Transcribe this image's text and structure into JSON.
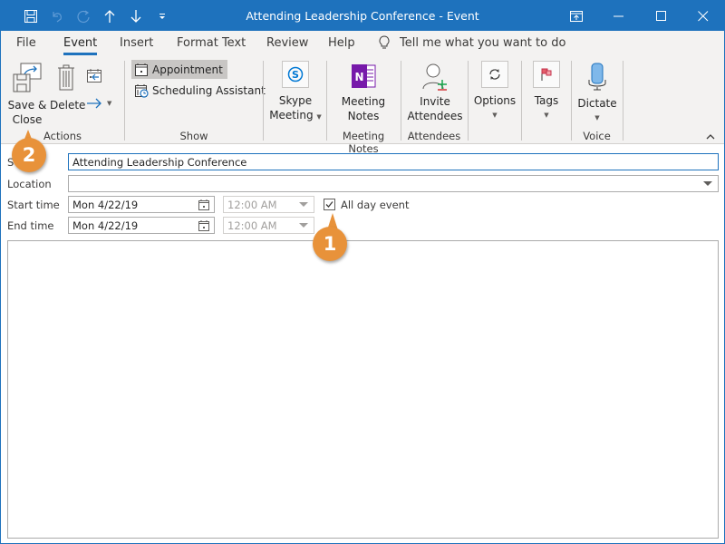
{
  "window": {
    "title": "Attending Leadership Conference  -  Event"
  },
  "quick_access": [
    {
      "icon": "save-icon"
    },
    {
      "icon": "undo-icon"
    },
    {
      "icon": "redo-icon"
    },
    {
      "icon": "up-arrow-icon"
    },
    {
      "icon": "down-arrow-icon"
    },
    {
      "icon": "customize-icon"
    }
  ],
  "menu_tabs": [
    {
      "label": "File"
    },
    {
      "label": "Event",
      "active": true
    },
    {
      "label": "Insert"
    },
    {
      "label": "Format Text"
    },
    {
      "label": "Review"
    },
    {
      "label": "Help"
    }
  ],
  "tell_me": {
    "placeholder": "Tell me what you want to do"
  },
  "ribbon": {
    "actions": {
      "label": "Actions",
      "save_close_line1": "Save &",
      "save_close_line2": "Close",
      "delete": "Delete"
    },
    "show": {
      "label": "Show",
      "appointment": "Appointment",
      "scheduling_assistant": "Scheduling Assistant"
    },
    "skype": {
      "line1": "Skype",
      "line2": "Meeting"
    },
    "meeting_notes": {
      "label": "Meeting Notes",
      "line1": "Meeting",
      "line2": "Notes"
    },
    "attendees": {
      "label": "Attendees",
      "line1": "Invite",
      "line2": "Attendees"
    },
    "options": {
      "label": "Options"
    },
    "tags": {
      "label": "Tags"
    },
    "voice": {
      "label": "Voice",
      "dictate": "Dictate"
    }
  },
  "form": {
    "subject_label": "S",
    "subject_value": "Attending Leadership Conference",
    "location_label": "Location",
    "location_value": "",
    "start_label": "Start time",
    "start_date": "Mon 4/22/19",
    "start_time": "12:00 AM",
    "end_label": "End time",
    "end_date": "Mon 4/22/19",
    "end_time": "12:00 AM",
    "all_day_label": "All day event",
    "all_day_checked": true
  },
  "callouts": [
    {
      "number": "1",
      "target": "all-day-checkbox"
    },
    {
      "number": "2",
      "target": "save-close-button"
    }
  ],
  "colors": {
    "accent": "#1e72bd",
    "callout": "#e8923a"
  }
}
